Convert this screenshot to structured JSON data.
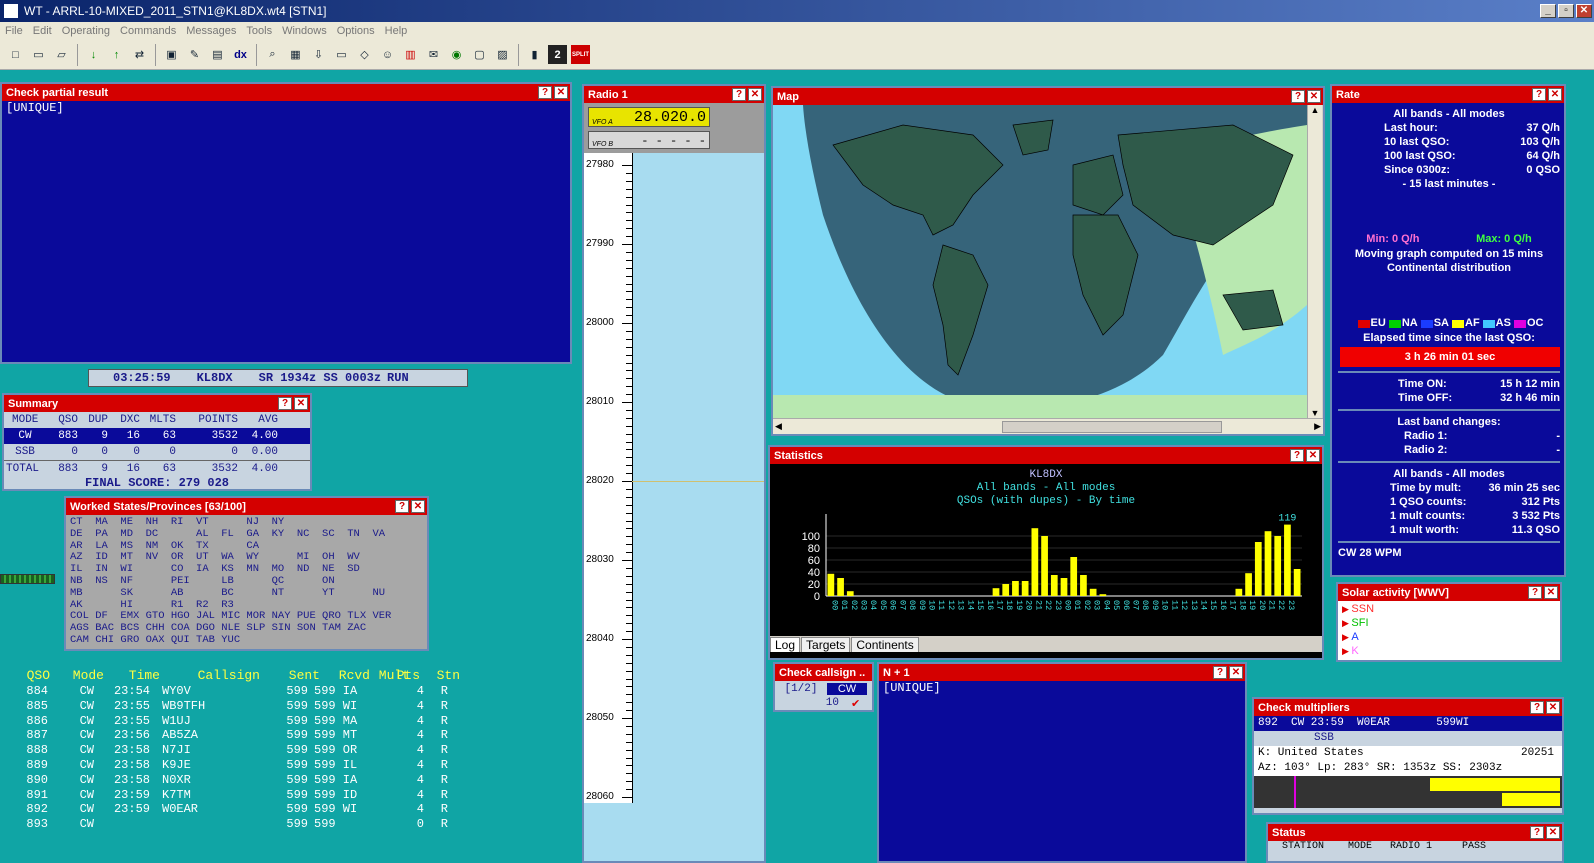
{
  "window": {
    "title": "WT - ARRL-10-MIXED_2011_STN1@KL8DX.wt4 [STN1]",
    "min": "_",
    "max": "▫",
    "close": "✕"
  },
  "menu": [
    "File",
    "Edit",
    "Operating",
    "Commands",
    "Messages",
    "Tools",
    "Windows",
    "Options",
    "Help"
  ],
  "toolbar": {
    "dx_label": "dx",
    "split_label": "SPLIT"
  },
  "check_partial": {
    "title": "Check partial result",
    "text": "[UNIQUE]"
  },
  "status_strip": {
    "time": "03:25:59",
    "call": "KL8DX",
    "sun": "SR 1934z  SS 0003z",
    "mode": "RUN"
  },
  "summary": {
    "title": "Summary",
    "headers": [
      "MODE",
      "QSO",
      "DUP",
      "DXC",
      "MLTS",
      "POINTS",
      "AVG"
    ],
    "rows": [
      [
        "CW",
        "883",
        "9",
        "16",
        "63",
        "3532",
        "4.00"
      ],
      [
        "SSB",
        "0",
        "0",
        "0",
        "0",
        "0",
        "0.00"
      ],
      [
        "TOTAL",
        "883",
        "9",
        "16",
        "63",
        "3532",
        "4.00"
      ]
    ],
    "final": "FINAL SCORE: 279 028"
  },
  "worked": {
    "title": "Worked States/Provinces [63/100]",
    "grid": "CT  MA  ME  NH  RI  VT      NJ  NY\nDE  PA  MD  DC      AL  FL  GA  KY  NC  SC  TN  VA\nAR  LA  MS  NM  OK  TX      CA\nAZ  ID  MT  NV  OR  UT  WA  WY      MI  OH  WV\nIL  IN  WI      CO  IA  KS  MN  MO  ND  NE  SD\nNB  NS  NF      PEI     LB      QC      ON\nMB      SK      AB      BC      NT      YT      NU\nAK      HI      R1  R2  R3\nCOL DF  EMX GTO HGO JAL MIC MOR NAY PUE QRO TLX VER\nAGS BAC BCS CHH COA DGO NLE SLP SIN SON TAM ZAC\nCAM CHI GRO OAX QUI TAB YUC"
  },
  "log": {
    "headers": [
      "QSO",
      "Mode",
      "Time",
      "Callsign",
      "Sent",
      "Rcvd",
      "Mult",
      "Pts",
      "Stn"
    ],
    "rows": [
      [
        "884",
        "CW",
        "23:54",
        "WY0V",
        "599",
        "599 IA",
        "",
        "4",
        "R"
      ],
      [
        "885",
        "CW",
        "23:55",
        "WB9TFH",
        "599",
        "599 WI",
        "",
        "4",
        "R"
      ],
      [
        "886",
        "CW",
        "23:55",
        "W1UJ",
        "599",
        "599 MA",
        "",
        "4",
        "R"
      ],
      [
        "887",
        "CW",
        "23:56",
        "AB5ZA",
        "599",
        "599 MT",
        "",
        "4",
        "R"
      ],
      [
        "888",
        "CW",
        "23:58",
        "N7JI",
        "599",
        "599 OR",
        "",
        "4",
        "R"
      ],
      [
        "889",
        "CW",
        "23:58",
        "K9JE",
        "599",
        "599 IL",
        "",
        "4",
        "R"
      ],
      [
        "890",
        "CW",
        "23:58",
        "N0XR",
        "599",
        "599 IA",
        "",
        "4",
        "R"
      ],
      [
        "891",
        "CW",
        "23:59",
        "K7TM",
        "599",
        "599 ID",
        "",
        "4",
        "R"
      ],
      [
        "892",
        "CW",
        "23:59",
        "W0EAR",
        "599",
        "599 WI",
        "",
        "4",
        "R"
      ],
      [
        "893",
        "CW",
        "",
        "",
        "599",
        "599",
        "",
        "0",
        "R"
      ]
    ]
  },
  "radio": {
    "title": "Radio 1",
    "vfoa_label": "VFO A",
    "vfoa": "28.020.0",
    "vfob_label": "VFO B",
    "vfob": "- - - - -",
    "scale": [
      "27980",
      "27990",
      "28000",
      "28010",
      "28020",
      "28030",
      "28040",
      "28050",
      "28060"
    ]
  },
  "map": {
    "title": "Map"
  },
  "stats": {
    "title": "Statistics",
    "line1": "KL8DX",
    "line2": "All bands - All modes",
    "line3": "QSOs (with dupes) - By time",
    "tabs": [
      "Log",
      "Targets",
      "Continents"
    ]
  },
  "chart_data": {
    "type": "bar",
    "ylim": [
      0,
      120
    ],
    "yticks": [
      "0",
      "20",
      "40",
      "60",
      "80",
      "100"
    ],
    "peak_label": "119",
    "categories": [
      "00",
      "01",
      "02",
      "03",
      "04",
      "05",
      "06",
      "07",
      "08",
      "09",
      "10",
      "11",
      "12",
      "13",
      "14",
      "15",
      "16",
      "17",
      "18",
      "19",
      "20",
      "21",
      "22",
      "23",
      "00",
      "01",
      "02",
      "03",
      "04",
      "05",
      "06",
      "07",
      "08",
      "09",
      "10",
      "11",
      "12",
      "13",
      "14",
      "15",
      "16",
      "17",
      "18",
      "19",
      "20",
      "21",
      "22",
      "23"
    ],
    "values": [
      37,
      30,
      8,
      0,
      0,
      0,
      0,
      0,
      0,
      0,
      0,
      0,
      0,
      0,
      0,
      0,
      0,
      13,
      20,
      25,
      25,
      113,
      100,
      35,
      30,
      65,
      35,
      12,
      3,
      0,
      0,
      0,
      0,
      0,
      0,
      0,
      0,
      0,
      0,
      0,
      0,
      0,
      12,
      38,
      90,
      108,
      100,
      119,
      45
    ]
  },
  "check_call": {
    "title": "Check callsign ..",
    "page": "[1/2]",
    "mode": "CW",
    "band": "10",
    "mark": "✔"
  },
  "nplus1": {
    "title": "N + 1",
    "text": "[UNIQUE]"
  },
  "rate": {
    "title": "Rate",
    "header": "All bands - All modes",
    "lines": [
      [
        "Last hour:",
        "37 Q/h"
      ],
      [
        "10 last QSO:",
        "103 Q/h"
      ],
      [
        "100 last QSO:",
        "64 Q/h"
      ],
      [
        "Since 0300z:",
        "0 QSO"
      ]
    ],
    "last15": "- 15 last minutes -",
    "min": "Min: 0 Q/h",
    "max": "Max: 0 Q/h",
    "moving": "Moving graph computed on 15 mins",
    "cont": "Continental distribution",
    "legend": [
      [
        "EU",
        "#e00000"
      ],
      [
        "NA",
        "#00d000"
      ],
      [
        "SA",
        "#1a3cff"
      ],
      [
        "AF",
        "#ffff00"
      ],
      [
        "AS",
        "#40c8ff"
      ],
      [
        "OC",
        "#e000e0"
      ]
    ],
    "elapsed_label": "Elapsed time since the last QSO:",
    "elapsed": "3 h 26 min 01 sec",
    "time_on": [
      "Time ON:",
      "15 h 12 min"
    ],
    "time_off": [
      "Time OFF:",
      "32 h 46 min"
    ],
    "band_changes": "Last band changes:",
    "radio1": [
      "Radio 1:",
      "-"
    ],
    "radio2": [
      "Radio 2:",
      "-"
    ],
    "all2": "All bands - All modes",
    "lines2": [
      [
        "Time by mult:",
        "36 min 25 sec"
      ],
      [
        "1 QSO counts:",
        "312 Pts"
      ],
      [
        "1 mult counts:",
        "3 532 Pts"
      ],
      [
        "1 mult worth:",
        "11.3 QSO"
      ]
    ],
    "cw": "CW  28 WPM"
  },
  "solar": {
    "title": "Solar activity [WWV]",
    "items": [
      [
        "SSN",
        "#ff3030"
      ],
      [
        "SFI",
        "#00c000"
      ],
      [
        "A",
        "#1a3cff"
      ],
      [
        "K",
        "#ff66ff"
      ]
    ]
  },
  "check_mult": {
    "title": "Check multipliers",
    "row1": "892  CW 23:59  W0EAR       599WI",
    "row2": "SSB",
    "country": "K: United States",
    "num": "20251",
    "azline": "Az: 103°  Lp: 283°  SR: 1353z  SS: 2303z"
  },
  "status": {
    "title": "Status",
    "cols": "STATION    MODE   RADIO 1     PASS"
  }
}
